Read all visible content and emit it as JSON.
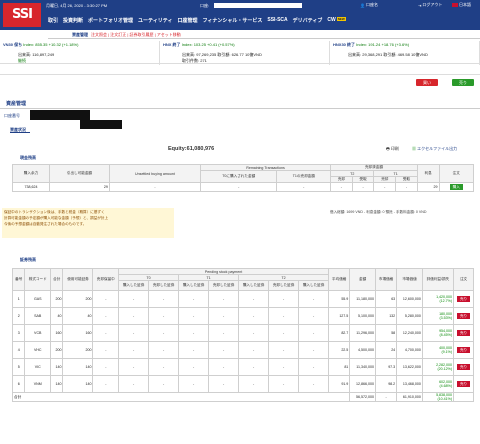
{
  "header": {
    "logo": "SSI",
    "datetime": "月曜日, 4月 26, 2020 - 3:30:27 PM",
    "account_label": "口座:",
    "user_label": "口座名",
    "logout": "ログアウト",
    "lang": "日本語",
    "menu": [
      "取引",
      "投資判断",
      "ポートフォリオ管理",
      "ユーティリティ",
      "口座管理",
      "フィナンシャル・サービス",
      "SSI-SCA",
      "デリバティブ",
      "CW"
    ],
    "menu_new_tag": "NEW",
    "submenu_title": "資産管理",
    "submenu_links": "注文照会 | 注文訂正 | 証券取引履歴 | アセット移動"
  },
  "tickers": [
    {
      "name": "VN30 保ち",
      "index": "Index: 855.35 +10.32 (+1.18%)",
      "vol_label": "出来高: 116,897,249",
      "status": "継続"
    },
    {
      "name": "HNX 終了",
      "index": "Index: 103.25 +0.41 (+0.57%)",
      "vol_label": "出来高: 97,269,235",
      "value": "取引額: 626.77 10億VND",
      "extra": "取引件数: 271"
    },
    {
      "name": "HNX30 終了",
      "index": "Index: 191.24 +18.76 (+3.6%)",
      "vol_label": "出来高: 29,368,291",
      "value": "取引額: 469.58 10億VND"
    }
  ],
  "top_buttons": {
    "buy": "買い",
    "sell": "売り"
  },
  "page": {
    "title": "資産管理",
    "account_row": "口座番号",
    "tab": "資産状況",
    "equity_label": "Equity:",
    "equity_value": "61,080,976",
    "print": "印刷",
    "excel": "エクセルファイル出力"
  },
  "cash": {
    "section": "現金残高",
    "headers": [
      "購入余力",
      "引出し可能金額",
      "Unsettled buying amount",
      "T0に購入された金額",
      "T1の売却金額",
      "T2",
      "T1",
      "利息",
      "注文"
    ],
    "group_headers": {
      "remaining": "Remaining Transactions",
      "sell": "売却済金額",
      "t2": "T2",
      "t1": "T1"
    },
    "sub_headers": [
      "売却",
      "受取",
      "売却",
      "受取"
    ],
    "row": {
      "buying_power": "738,624",
      "withdraw": "29",
      "unsettled": "-",
      "t0": "-",
      "t1sold": "-",
      "s1": "-",
      "s2": "-",
      "s3": "-",
      "s4": "-",
      "interest": "29",
      "buy": "購入"
    },
    "note": [
      "保証中のトランザクション後は、手数と税金（概算）に基ずく",
      "計算可能金額の予定額が購入可能な金額（予想）と、損益が計上",
      "今後の予想金額は自動発注された場合のものです。"
    ],
    "fees": "借入総額: 1699 VND - 利息金額: 0 預託 - 手数料金額: 0 VND"
  },
  "stocks": {
    "section": "証券残高",
    "group_header": "Pending stock payment",
    "t0": "T0",
    "t1": "T1",
    "t2": "T2",
    "headers": [
      "番号",
      "株式コード",
      "合計",
      "使用可能証券",
      "売却保留中",
      "購入した証券",
      "売却した証券",
      "購入した証券",
      "売却した証券",
      "購入した証券",
      "売却した証券",
      "購入した証券",
      "平均価格",
      "金額",
      "市場価格",
      "市場価値",
      "評価利益/損失",
      "注文"
    ],
    "rows": [
      {
        "no": "1",
        "code": "GAS",
        "total": "200",
        "avail": "200",
        "avg": "55.9",
        "amount": "11,180,000",
        "price": "63",
        "value": "12,600,000",
        "pl": "1,420,000",
        "plp": "(12.7%)",
        "action": "売り"
      },
      {
        "no": "2",
        "code": "SAB",
        "total": "40",
        "avail": "40",
        "avg": "127.5",
        "amount": "5,100,000",
        "price": "132",
        "value": "5,280,000",
        "pl": "180,000",
        "plp": "(3.53%)",
        "action": "売り"
      },
      {
        "no": "3",
        "code": "VCB",
        "total": "160",
        "avail": "160",
        "avg": "82.7",
        "amount": "11,296,000",
        "price": "58",
        "value": "12,240,000",
        "pl": "954,000",
        "plp": "(8.45%)",
        "action": "売り"
      },
      {
        "no": "4",
        "code": "VHC",
        "total": "200",
        "avail": "200",
        "avg": "22.5",
        "amount": "4,500,000",
        "price": "24",
        "value": "4,700,000",
        "pl": "400,000",
        "plp": "(9.1%)",
        "action": "売り"
      },
      {
        "no": "5",
        "code": "VIC",
        "total": "140",
        "avail": "140",
        "avg": "81",
        "amount": "11,340,000",
        "price": "97.3",
        "value": "13,622,000",
        "pl": "2,282,000",
        "plp": "(20.12%)",
        "action": "売り"
      },
      {
        "no": "6",
        "code": "VNM",
        "total": "140",
        "avail": "140",
        "avg": "91.9",
        "amount": "12,866,000",
        "price": "98.2",
        "value": "13,468,000",
        "pl": "602,000",
        "plp": "(4.68%)",
        "action": "売り"
      }
    ],
    "total_label": "合計",
    "total_amount": "56,572,000",
    "total_value": "61,910,000",
    "total_pl": "5,838,000",
    "total_plp": "(10.41%)"
  }
}
